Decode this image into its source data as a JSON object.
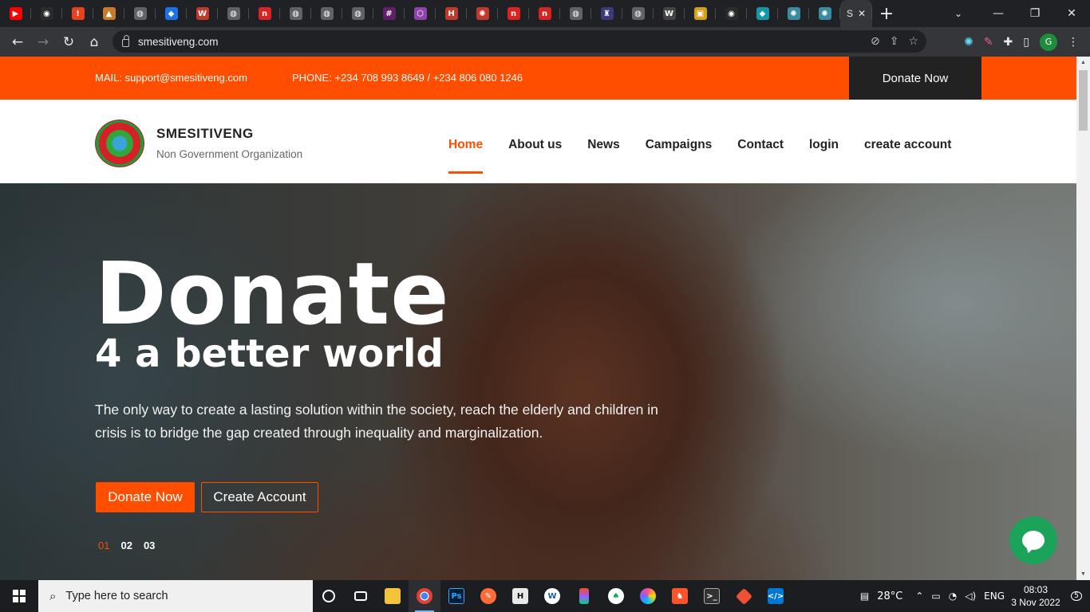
{
  "browser": {
    "tabs": [
      {
        "icon": "youtube-icon",
        "glyph": "▶",
        "color": "#ff0000"
      },
      {
        "icon": "github-icon",
        "glyph": "◉",
        "color": "#2b2b2b"
      },
      {
        "icon": "alert-icon",
        "glyph": "!",
        "color": "#e8411f"
      },
      {
        "icon": "app-icon",
        "glyph": "▲",
        "color": "#c97a2b"
      },
      {
        "icon": "globe-icon",
        "glyph": "◍",
        "color": "#5f6368"
      },
      {
        "icon": "docs-icon",
        "glyph": "◆",
        "color": "#1a73e8"
      },
      {
        "icon": "w-icon",
        "glyph": "W",
        "color": "#c0392b"
      },
      {
        "icon": "globe-icon",
        "glyph": "◍",
        "color": "#5f6368"
      },
      {
        "icon": "n-icon",
        "glyph": "n",
        "color": "#d9231f"
      },
      {
        "icon": "globe-icon",
        "glyph": "◍",
        "color": "#5f6368"
      },
      {
        "icon": "globe-icon",
        "glyph": "◍",
        "color": "#5f6368"
      },
      {
        "icon": "globe-icon",
        "glyph": "◍",
        "color": "#5f6368"
      },
      {
        "icon": "slack-icon",
        "glyph": "#",
        "color": "#611f69"
      },
      {
        "icon": "graphql-icon",
        "glyph": "⬡",
        "color": "#8e44ad"
      },
      {
        "icon": "hub-icon",
        "glyph": "H",
        "color": "#c0392b"
      },
      {
        "icon": "react-icon",
        "glyph": "✺",
        "color": "#c0392b"
      },
      {
        "icon": "n-icon",
        "glyph": "n",
        "color": "#d9231f"
      },
      {
        "icon": "n-icon",
        "glyph": "n",
        "color": "#d9231f"
      },
      {
        "icon": "globe-icon",
        "glyph": "◍",
        "color": "#5f6368"
      },
      {
        "icon": "crest-icon",
        "glyph": "♜",
        "color": "#3b3b7a"
      },
      {
        "icon": "globe-icon",
        "glyph": "◍",
        "color": "#5f6368"
      },
      {
        "icon": "webflow-icon",
        "glyph": "W",
        "color": "#444"
      },
      {
        "icon": "ikea-icon",
        "glyph": "▣",
        "color": "#d4a017"
      },
      {
        "icon": "github-icon",
        "glyph": "◉",
        "color": "#2b2b2b"
      },
      {
        "icon": "diamond-icon",
        "glyph": "◆",
        "color": "#1497a8"
      },
      {
        "icon": "react-icon",
        "glyph": "✺",
        "color": "#3a8ba0"
      },
      {
        "icon": "react-icon",
        "glyph": "✺",
        "color": "#3a8ba0"
      }
    ],
    "active_tab_label": "S",
    "url": "smesitiveng.com"
  },
  "site": {
    "topbar": {
      "mail": "MAIL: support@smesitiveng.com",
      "phone": "PHONE: +234 708 993 8649 / +234 806 080 1246",
      "donate": "Donate Now"
    },
    "brand": "SMESITIVENG",
    "tagline": "Non Government Organization",
    "nav": [
      "Home",
      "About us",
      "News",
      "Campaigns",
      "Contact",
      "login",
      "create account"
    ],
    "hero": {
      "title": "Donate",
      "subtitle": "4 a better world",
      "text": "The only way to create a lasting solution within the society, reach the elderly and children in crisis is to bridge the gap created through inequality and marginalization.",
      "primary_button": "Donate Now",
      "secondary_button": "Create Account",
      "slides": [
        "01",
        "02",
        "03"
      ],
      "active_slide": "01"
    },
    "accent_color": "#ff4e00"
  },
  "taskbar": {
    "search_placeholder": "Type here to search",
    "weather": "28°C",
    "lang": "ENG",
    "time": "08:03",
    "date": "3 Nov 2022",
    "notifications": "5"
  }
}
